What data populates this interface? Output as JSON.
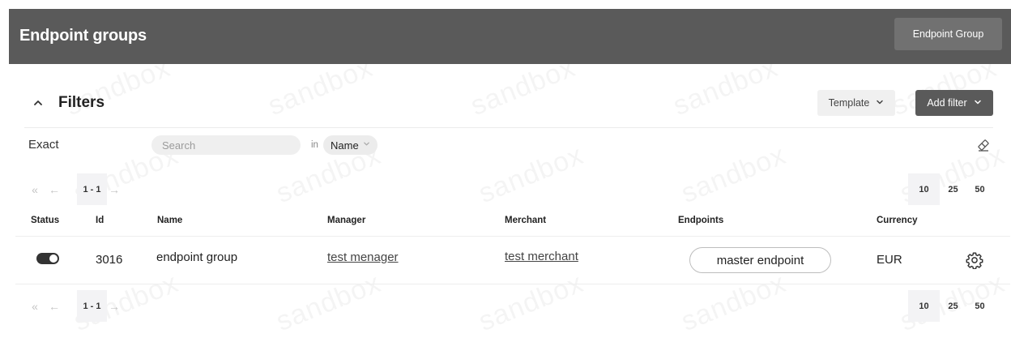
{
  "header": {
    "title": "Endpoint groups",
    "action_button": "Endpoint Group"
  },
  "watermark": "sandbox",
  "filters": {
    "title": "Filters",
    "template_label": "Template",
    "add_filter_label": "Add filter",
    "row": {
      "mode_label": "Exact",
      "search_placeholder": "Search",
      "in_label": "in",
      "field_select": "Name"
    }
  },
  "pagination": {
    "first": "«",
    "prev": "←",
    "range": "1 - 1",
    "next": "→",
    "page_sizes": [
      "10",
      "25",
      "50"
    ],
    "active_size": "10"
  },
  "table": {
    "columns": [
      "Status",
      "Id",
      "Name",
      "Manager",
      "Merchant",
      "Endpoints",
      "Currency"
    ],
    "rows": [
      {
        "status": "on",
        "id": "3016",
        "name": "endpoint group",
        "manager": "test menager",
        "merchant": "test merchant",
        "endpoints": "master endpoint",
        "currency": "EUR"
      }
    ]
  },
  "colors": {
    "header_bg": "#5a5a5a",
    "header_button_bg": "#717171",
    "primary_button_bg": "#5a5a5a"
  },
  "icons": {
    "collapse": "chevron-up-icon",
    "dropdown": "chevron-down-icon",
    "clear": "eraser-icon",
    "settings": "gear-icon"
  }
}
